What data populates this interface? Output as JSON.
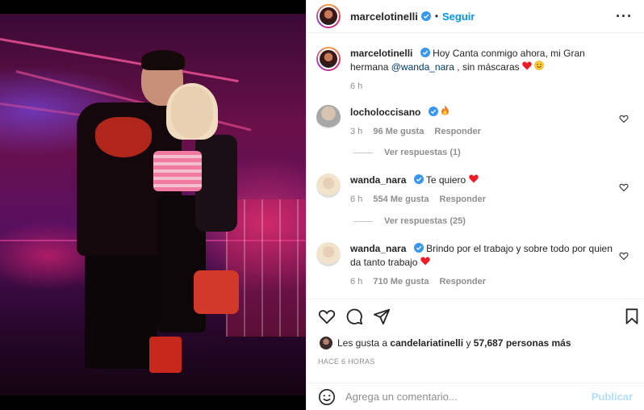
{
  "post": {
    "author": "marcelotinelli",
    "follow_label": "Seguir",
    "dot": "•",
    "more_icon": "more-horizontal-icon"
  },
  "caption": {
    "user": "marcelotinelli",
    "text_before": "Hoy Canta conmigo ahora, mi Gran hermana",
    "mention": "@wanda_nara",
    "text_after": ", sin máscaras",
    "emojis": [
      "red-heart",
      "smiling-face"
    ],
    "time": "6 h"
  },
  "comments": [
    {
      "user": "locholoccisano",
      "text": "",
      "emoji": "fire",
      "time": "3 h",
      "likes": "96 Me gusta",
      "reply_label": "Responder",
      "replies_label": "Ver respuestas (1)"
    },
    {
      "user": "wanda_nara",
      "text": "Te quiero",
      "emoji": "red-heart",
      "time": "6 h",
      "likes": "554 Me gusta",
      "reply_label": "Responder",
      "replies_label": "Ver respuestas (25)"
    },
    {
      "user": "wanda_nara",
      "text": "Brindo por el trabajo y sobre todo por quien da tanto trabajo",
      "emoji": "red-heart",
      "time": "6 h",
      "likes": "710 Me gusta",
      "reply_label": "Responder"
    }
  ],
  "likes": {
    "prefix": "Les gusta a",
    "user": "candelariatinelli",
    "middle": "y",
    "count": "57,687 personas más"
  },
  "timestamp": "HACE 6 HORAS",
  "composer": {
    "placeholder": "Agrega un comentario...",
    "publish_label": "Publicar"
  },
  "colors": {
    "accent": "#0095f6",
    "verified": "#3897f0",
    "heart": "#ed4956",
    "publish_disabled": "#b2dffc"
  }
}
